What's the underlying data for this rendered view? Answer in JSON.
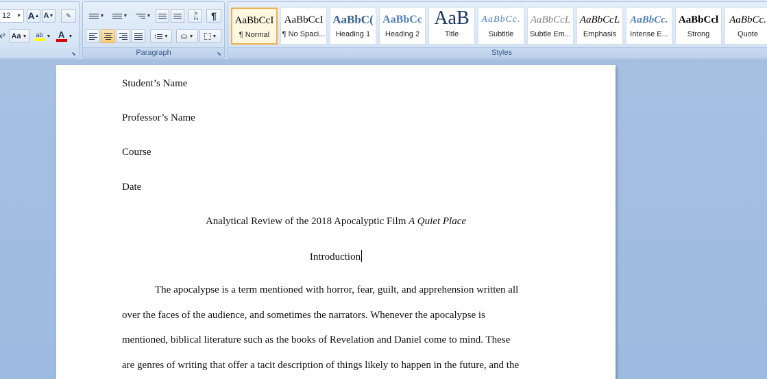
{
  "font": {
    "size_value": "12",
    "grow_label": "A",
    "shrink_label": "A",
    "change_case_label": "Aa",
    "highlight_label": "ab",
    "font_color_label": "A",
    "highlight_color": "#ffff00",
    "font_color": "#d40000"
  },
  "paragraph": {
    "group_label": "Paragraph",
    "sort_label": "A↓Z",
    "show_marks_label": "¶"
  },
  "styles": {
    "group_label": "Styles",
    "items": [
      {
        "preview": "AaBbCcI",
        "name": "¶ Normal",
        "color": "#000000"
      },
      {
        "preview": "AaBbCcI",
        "name": "¶ No Spaci...",
        "color": "#000000"
      },
      {
        "preview": "AaBbC(",
        "name": "Heading 1",
        "color": "#365f91"
      },
      {
        "preview": "AaBbCc",
        "name": "Heading 2",
        "color": "#4f81bd"
      },
      {
        "preview": "AaB",
        "name": "Title",
        "color": "#17365d"
      },
      {
        "preview": "AaBbCc.",
        "name": "Subtitle",
        "color": "#4f81bd"
      },
      {
        "preview": "AaBbCcL",
        "name": "Subtle Em...",
        "color": "#808080"
      },
      {
        "preview": "AaBbCcL",
        "name": "Emphasis",
        "color": "#000000"
      },
      {
        "preview": "AaBbCc.",
        "name": "Intense E...",
        "color": "#4f81bd"
      },
      {
        "preview": "AaBbCcl",
        "name": "Strong",
        "color": "#000000"
      },
      {
        "preview": "AaBbCc.",
        "name": "Quote",
        "color": "#000000"
      }
    ]
  },
  "document": {
    "student_name": "Student’s Name",
    "professor_name": "Professor’s Name",
    "course": "Course",
    "date": "Date",
    "title_text": "Analytical Review of the 2018 Apocalyptic Film ",
    "title_film": "A Quiet Place",
    "heading": "Introduction",
    "paragraph_lines": [
      "The apocalypse is a term mentioned with horror, fear, guilt, and apprehension written all",
      "over the faces of the audience, and sometimes the narrators. Whenever the apocalypse is",
      "mentioned, biblical literature such as the books of Revelation and Daniel come to mind. These",
      "are genres of writing that offer a tacit description of things likely to happen in the future, and the"
    ]
  }
}
